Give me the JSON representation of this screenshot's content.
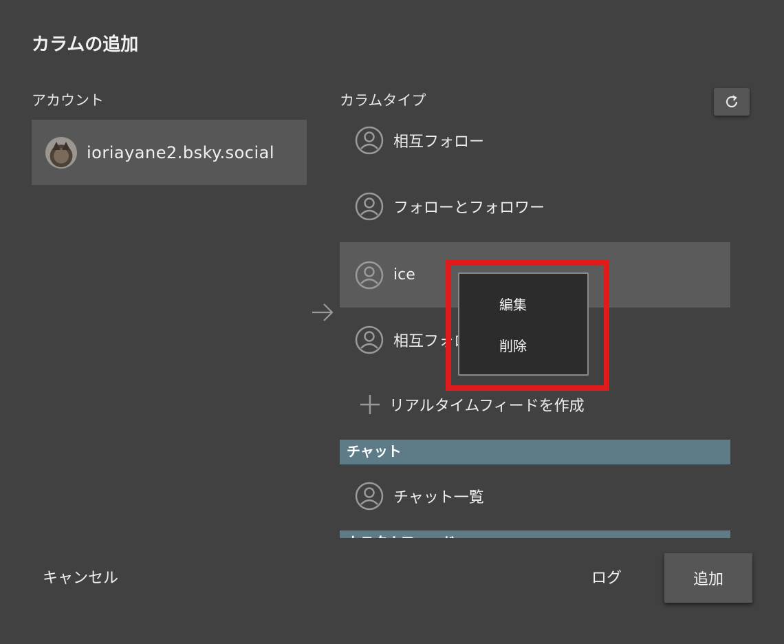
{
  "dialog": {
    "title": "カラムの追加"
  },
  "account": {
    "label": "アカウント",
    "handle": "ioriayane2.bsky.social"
  },
  "column_type": {
    "label": "カラムタイプ",
    "items": [
      {
        "label": "相互フォロー",
        "icon": "user-circle-icon"
      },
      {
        "label": "フォローとフォロワー",
        "icon": "user-circle-icon"
      },
      {
        "label": "ice",
        "icon": "user-circle-icon",
        "selected": true
      },
      {
        "label": "相互フォローとfollowing",
        "icon": "user-circle-icon"
      }
    ],
    "add_realtime": "リアルタイムフィードを作成",
    "chat_section": "チャット",
    "chat_list": "チャット一覧",
    "next_section": "カスタムフィード"
  },
  "context_menu": {
    "edit": "編集",
    "delete": "削除"
  },
  "footer": {
    "cancel": "キャンセル",
    "log": "ログ",
    "add": "追加"
  },
  "colors": {
    "background": "#414141",
    "selected_row": "#5b5b5b",
    "section_header": "#5e7b88",
    "highlight": "#e01b1b"
  }
}
